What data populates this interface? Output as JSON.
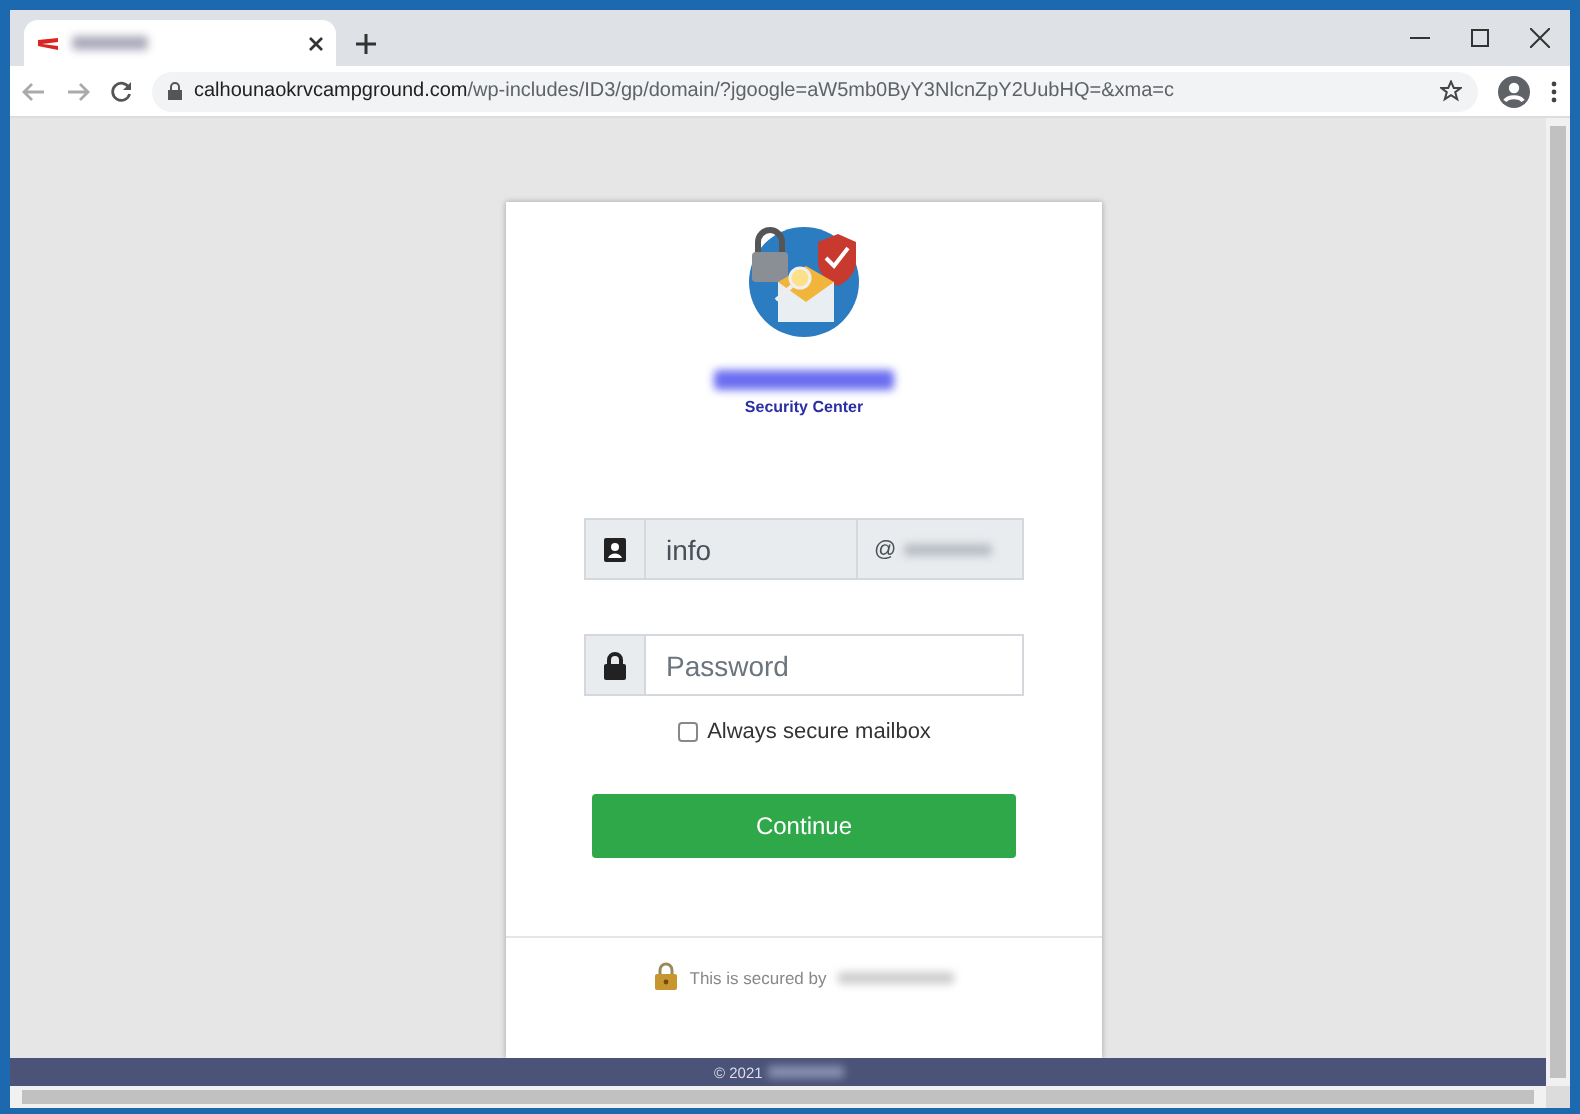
{
  "browser": {
    "address": {
      "host": "calhounaokrvcampground.com",
      "path": "/wp-includes/ID3/gp/domain/?jgoogle=aW5mb0ByY3NlcnZpY2UubHQ=&xma=c"
    }
  },
  "login": {
    "subtitle": "Security Center",
    "email_user": {
      "value": "info"
    },
    "at": "@",
    "password": {
      "placeholder": "Password"
    },
    "remember": {
      "label": "Always secure mailbox",
      "checked": false
    },
    "continue_button": "Continue",
    "secured_note": "This is secured by"
  },
  "footer": {
    "copyright": "© 2021"
  }
}
